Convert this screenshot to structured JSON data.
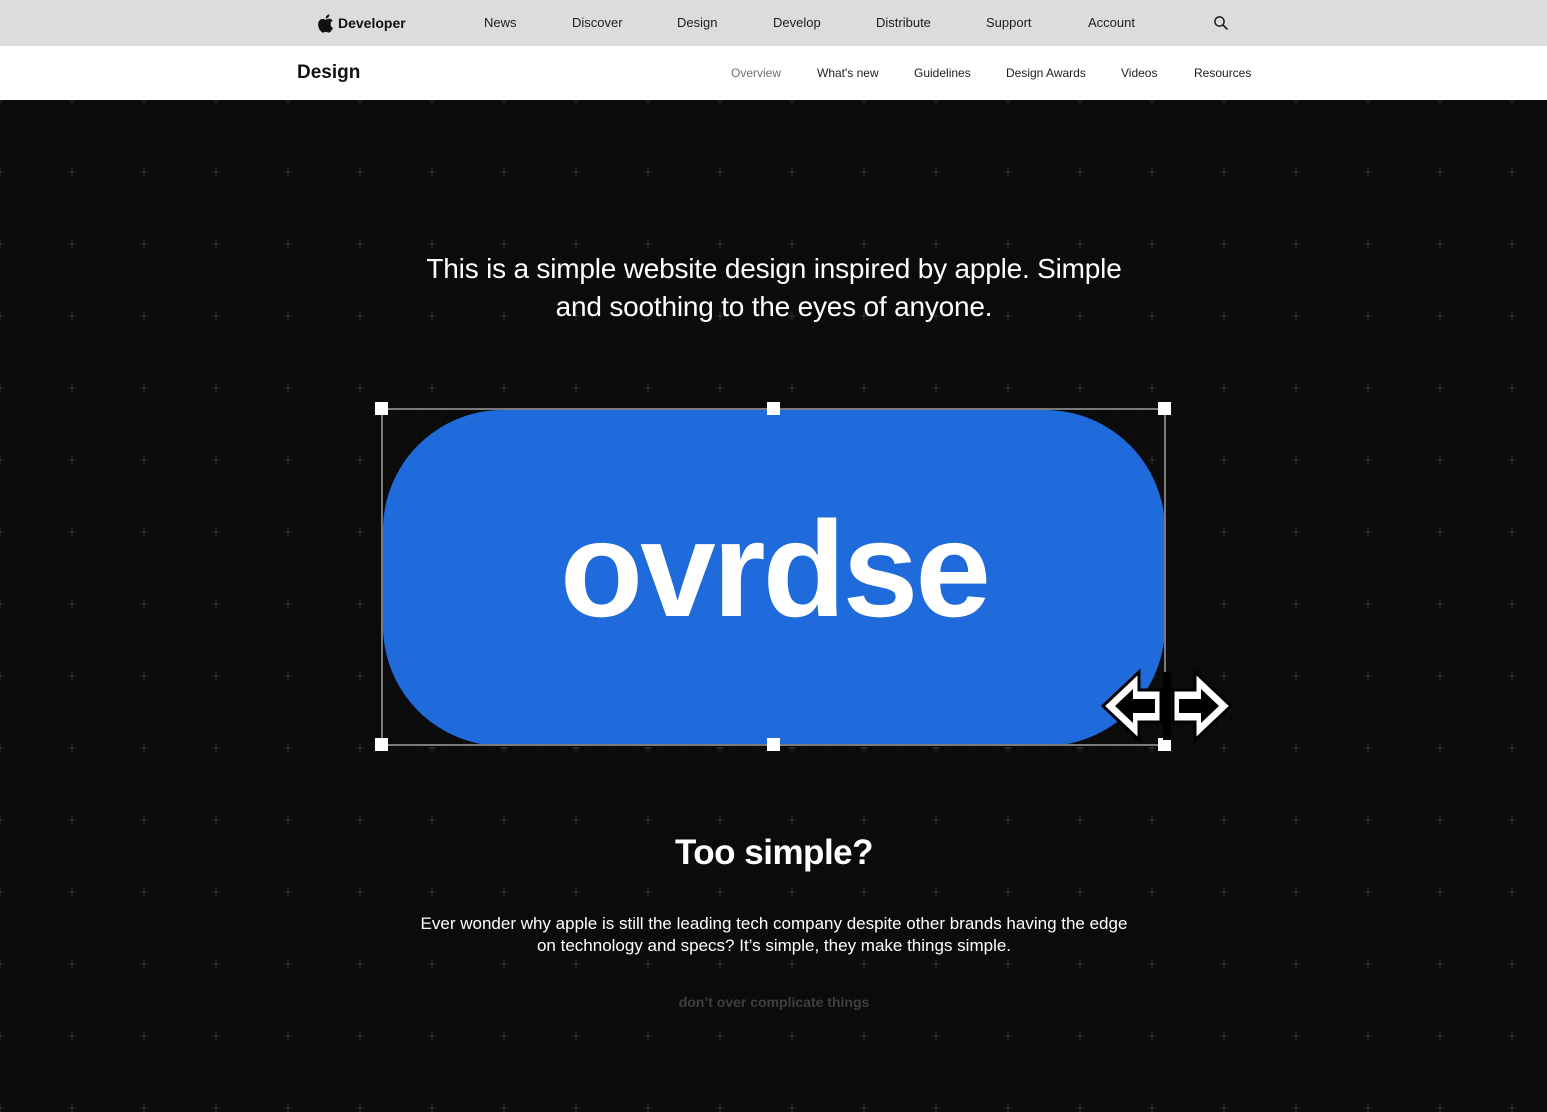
{
  "global_nav": {
    "brand_label": "Developer",
    "items": [
      "News",
      "Discover",
      "Design",
      "Develop",
      "Distribute",
      "Support",
      "Account"
    ]
  },
  "local_nav": {
    "section_title": "Design",
    "items": [
      "Overview",
      "What's new",
      "Guidelines",
      "Design Awards",
      "Videos",
      "Resources"
    ],
    "current": "Overview"
  },
  "hero": {
    "intro_line_1": "This is a simple website design inspired by apple. Simple",
    "intro_line_2": "and soothing to the eyes of anyone.",
    "logo_text": "ovrdse",
    "headline": "Too simple?",
    "body_line_1": "Ever wonder why apple is still the leading tech company despite other brands having the edge",
    "body_line_2": "on technology and specs? It’s simple, they make things simple.",
    "tagline": "don’t over complicate things"
  },
  "colors": {
    "accent_blue": "#1f6bdb",
    "page_background": "#0b0b0b",
    "global_nav_background": "#dcdcdc",
    "local_nav_background": "#ffffff",
    "tagline_gray": "#3f3f3f"
  },
  "icons": {
    "brand": "apple-logo-icon",
    "search": "search-icon",
    "cursor": "resize-horizontal-cursor-icon"
  }
}
